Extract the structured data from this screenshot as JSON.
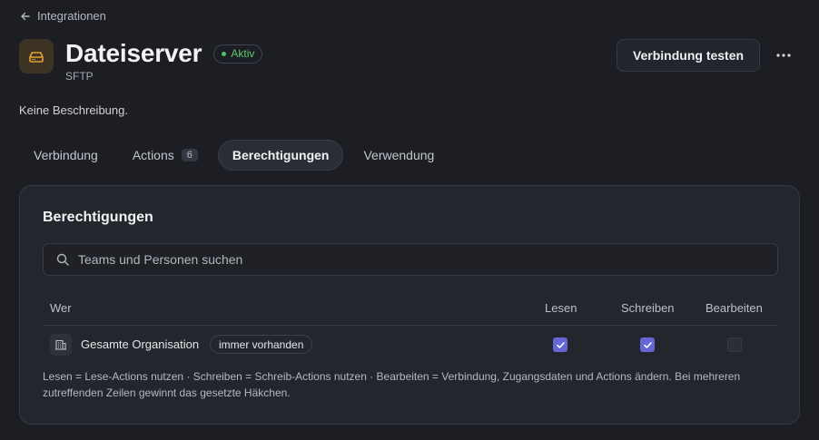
{
  "nav": {
    "back_label": "Integrationen"
  },
  "header": {
    "title": "Dateiserver",
    "status": "Aktiv",
    "subtitle": "SFTP",
    "test_button": "Verbindung testen"
  },
  "description": "Keine Beschreibung.",
  "tabs": [
    {
      "label": "Verbindung"
    },
    {
      "label": "Actions",
      "count": "6"
    },
    {
      "label": "Berechtigungen",
      "active": true
    },
    {
      "label": "Verwendung"
    }
  ],
  "permissions": {
    "title": "Berechtigungen",
    "search_placeholder": "Teams und Personen suchen",
    "columns": {
      "who": "Wer",
      "read": "Lesen",
      "write": "Schreiben",
      "edit": "Bearbeiten"
    },
    "rows": [
      {
        "name": "Gesamte Organisation",
        "tag": "immer vorhanden",
        "read": true,
        "write": true,
        "edit": false
      }
    ],
    "note": "Lesen = Lese-Actions nutzen · Schreiben = Schreib-Actions nutzen · Bearbeiten = Verbindung, Zugangsdaten und Actions ändern. Bei mehreren zutreffenden Zeilen gewinnt das gesetzte Häkchen."
  },
  "colors": {
    "accent": "#6567d8",
    "status_green": "#4cc36a",
    "icon_gold": "#e0a335",
    "background": "#1c1e24"
  },
  "icons": {
    "back": "arrow-left-icon",
    "app": "hard-drive-icon",
    "more": "ellipsis-icon",
    "search": "search-icon",
    "org": "building-icon",
    "check": "check-icon"
  }
}
